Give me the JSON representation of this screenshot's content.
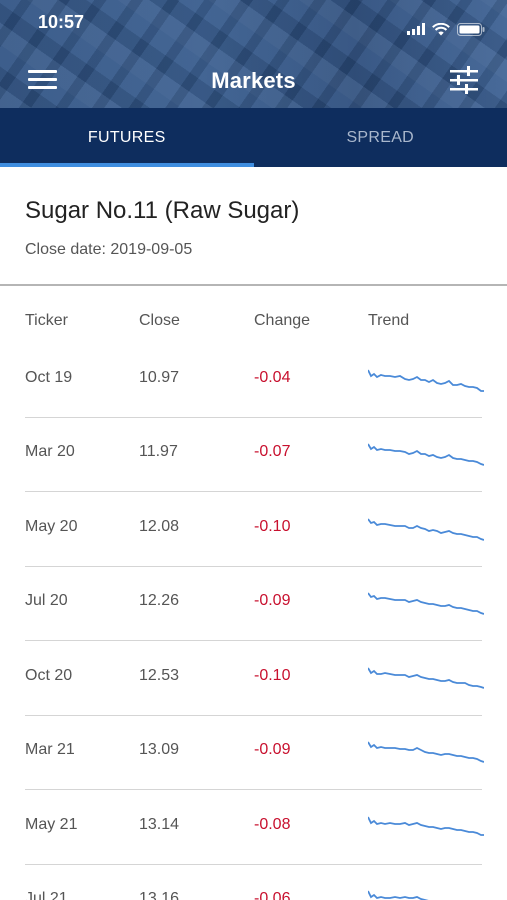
{
  "status_bar": {
    "time": "10:57"
  },
  "header": {
    "title": "Markets"
  },
  "tabs": [
    {
      "label": "FUTURES",
      "active": true
    },
    {
      "label": "SPREAD",
      "active": false
    }
  ],
  "commodity": {
    "name": "Sugar No.11 (Raw Sugar)",
    "close_date": "Close date: 2019-09-05"
  },
  "table": {
    "columns": [
      "Ticker",
      "Close",
      "Change",
      "Trend"
    ],
    "rows": [
      {
        "ticker": "Oct 19",
        "close": "10.97",
        "change": "-0.04"
      },
      {
        "ticker": "Mar 20",
        "close": "11.97",
        "change": "-0.07"
      },
      {
        "ticker": "May 20",
        "close": "12.08",
        "change": "-0.10"
      },
      {
        "ticker": "Jul 20",
        "close": "12.26",
        "change": "-0.09"
      },
      {
        "ticker": "Oct 20",
        "close": "12.53",
        "change": "-0.10"
      },
      {
        "ticker": "Mar 21",
        "close": "13.09",
        "change": "-0.09"
      },
      {
        "ticker": "May 21",
        "close": "13.14",
        "change": "-0.08"
      },
      {
        "ticker": "Jul 21",
        "close": "13.16",
        "change": "-0.06"
      }
    ]
  },
  "colors": {
    "header_bg": "#2a4a7a",
    "tab_bar_bg": "#0e2d5e",
    "tab_indicator": "#3f8ee0",
    "negative_change": "#c8102e",
    "sparkline": "#4a8ad8"
  },
  "icons": {
    "menu": "hamburger-icon",
    "filter": "sliders-icon",
    "signal": "cellular-signal-icon",
    "wifi": "wifi-icon",
    "battery": "battery-icon"
  }
}
